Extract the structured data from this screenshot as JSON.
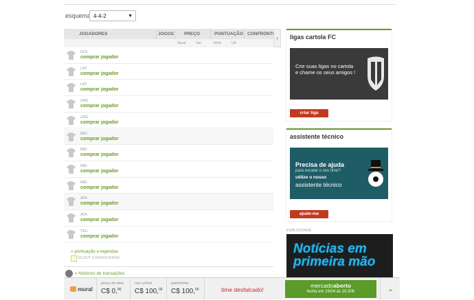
{
  "schema": {
    "label": "esquema",
    "value": "4-4-2"
  },
  "table": {
    "headers": {
      "players": "JOGADORES",
      "games": "JOGOS",
      "price": "PREÇO",
      "points": "PONTUAÇÃO",
      "match": "CONFRONTO"
    },
    "subheaders": {
      "current": "Atual",
      "var": "Var",
      "avg": "Méd",
      "last": "Ult"
    },
    "rows": [
      {
        "pos": "GOL",
        "action": "comprar jogador"
      },
      {
        "pos": "LAT",
        "action": "comprar jogador"
      },
      {
        "pos": "LAT",
        "action": "comprar jogador"
      },
      {
        "pos": "ZAG",
        "action": "comprar jogador"
      },
      {
        "pos": "ZAG",
        "action": "comprar jogador"
      },
      {
        "pos": "MEI",
        "action": "comprar jogador"
      },
      {
        "pos": "MEI",
        "action": "comprar jogador"
      },
      {
        "pos": "MEI",
        "action": "comprar jogador"
      },
      {
        "pos": "MEI",
        "action": "comprar jogador"
      },
      {
        "pos": "ATA",
        "action": "comprar jogador"
      },
      {
        "pos": "ATA",
        "action": "comprar jogador"
      },
      {
        "pos": "TEC",
        "action": "comprar jogador"
      }
    ]
  },
  "legend": {
    "points_link": "» pontuação e legendas",
    "scout": "SCOUT CONSOLIDADO"
  },
  "history": {
    "label": "» histórico de transações"
  },
  "leagues": {
    "title": "ligas cartola FC",
    "banner": "Crie suas ligas no cartola e chame os seus amigos !",
    "button": "criar liga"
  },
  "assistant": {
    "title": "assistente técnico",
    "banner_line1": "Precisa de ajuda",
    "banner_line2": "para escalar o seu time?",
    "banner_line3": "utilize o nosso",
    "banner_line4": "assistente técnico",
    "button": "ajude-me"
  },
  "ad": {
    "label": "PUBLICIDADE",
    "text_line1": "Notícias em",
    "text_line2": "primeira mão"
  },
  "footer": {
    "mural": "mural",
    "price_label": "preço do time",
    "price_value": "C$ 0,",
    "price_cents": "00",
    "coffers_label": "nos cofres",
    "coffers_value": "C$ 100,",
    "coffers_cents": "00",
    "patrimony_label": "patrimônio",
    "patrimony_value": "C$ 100,",
    "patrimony_cents": "00",
    "status": "time desfalcado!",
    "market_word": "mercado",
    "market_state": "aberto",
    "market_close": "fecha em 19/04 às 16:30h"
  },
  "colors": {
    "green": "#6a9b24",
    "red": "#c23a1e",
    "market_green": "#5a9b2a"
  }
}
